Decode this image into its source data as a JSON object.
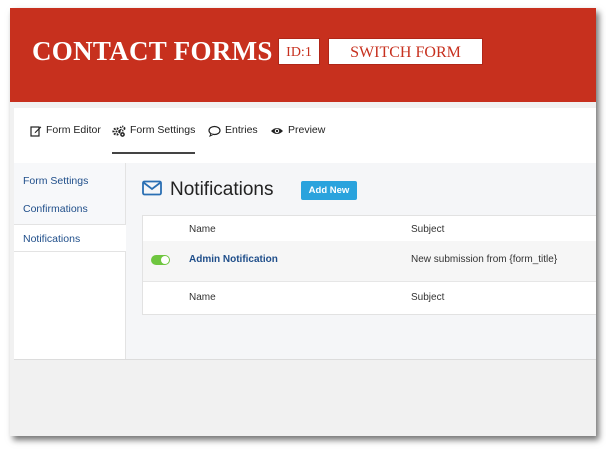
{
  "banner": {
    "title": "CONTACT FORMS",
    "id_badge": "ID:1",
    "switch_button": "SWITCH FORM",
    "color": "#c7301e"
  },
  "toolbar": {
    "tabs": [
      {
        "label": "Form Editor",
        "icon": "edit-icon"
      },
      {
        "label": "Form Settings",
        "icon": "gears-icon",
        "active": true
      },
      {
        "label": "Entries",
        "icon": "comment-icon"
      },
      {
        "label": "Preview",
        "icon": "eye-icon"
      }
    ]
  },
  "sidebar": {
    "items": [
      {
        "label": "Form Settings"
      },
      {
        "label": "Confirmations"
      },
      {
        "label": "Notifications",
        "active": true
      }
    ]
  },
  "main": {
    "heading": "Notifications",
    "heading_icon": "envelope-icon",
    "add_new": "Add New",
    "table": {
      "columns": [
        "Name",
        "Subject"
      ],
      "rows": [
        {
          "enabled": true,
          "name": "Admin Notification",
          "subject": "New submission from {form_title}"
        }
      ],
      "footer_columns": [
        "Name",
        "Subject"
      ]
    }
  },
  "colors": {
    "accent_blue": "#2aa3dd",
    "link_blue": "#1f4e8a",
    "toggle_green": "#6fc63f"
  }
}
